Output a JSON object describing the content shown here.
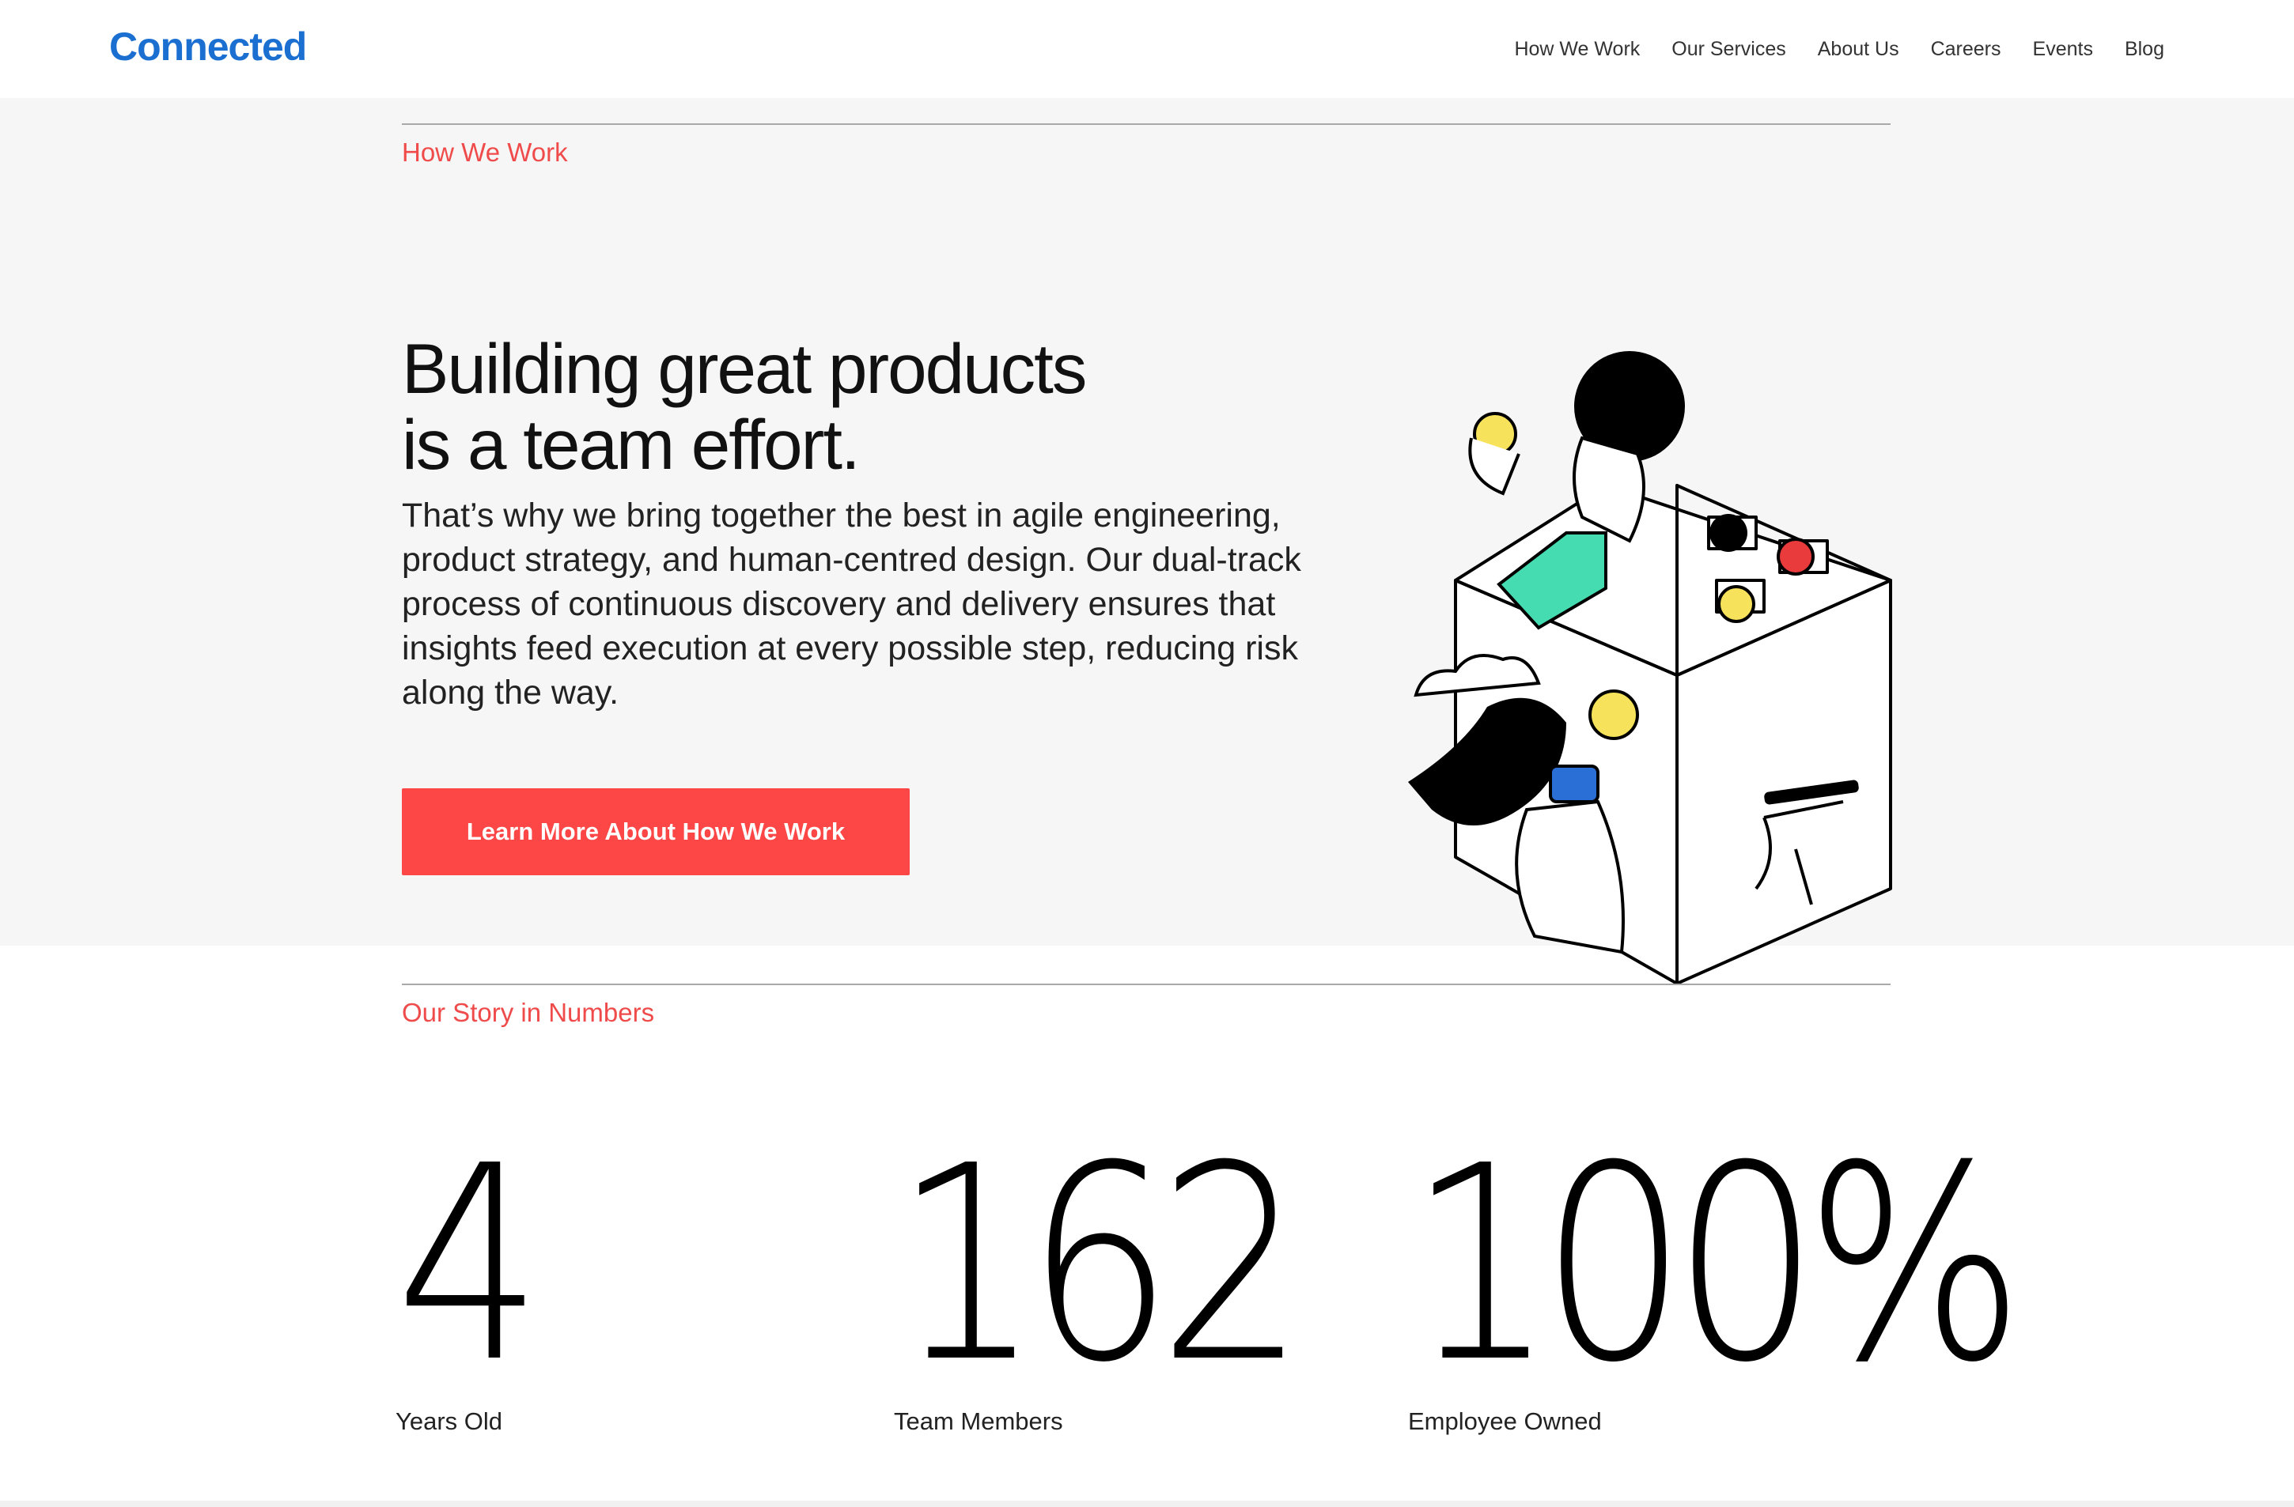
{
  "brand": {
    "name": "Connected",
    "color": "#1a6fd1"
  },
  "nav": {
    "items": [
      "How We Work",
      "Our Services",
      "About Us",
      "Careers",
      "Events",
      "Blog"
    ]
  },
  "hero": {
    "section_label": "How We Work",
    "headline_line1": "Building great products",
    "headline_line2": "is a team effort.",
    "body": "That’s why we bring together the best in agile engineering, product strategy, and human-centred design. Our dual-track process of continuous discovery and delivery ensures that insights feed execution at every possible step, reducing risk along the way.",
    "cta_label": "Learn More About How We Work",
    "accent_color": "#fd4747"
  },
  "stats": {
    "section_label": "Our Story in Numbers",
    "items": [
      {
        "value": "4",
        "caption": "Years Old"
      },
      {
        "value": "162",
        "caption": "Team Members"
      },
      {
        "value": "100%",
        "caption": "Employee Owned"
      }
    ]
  }
}
